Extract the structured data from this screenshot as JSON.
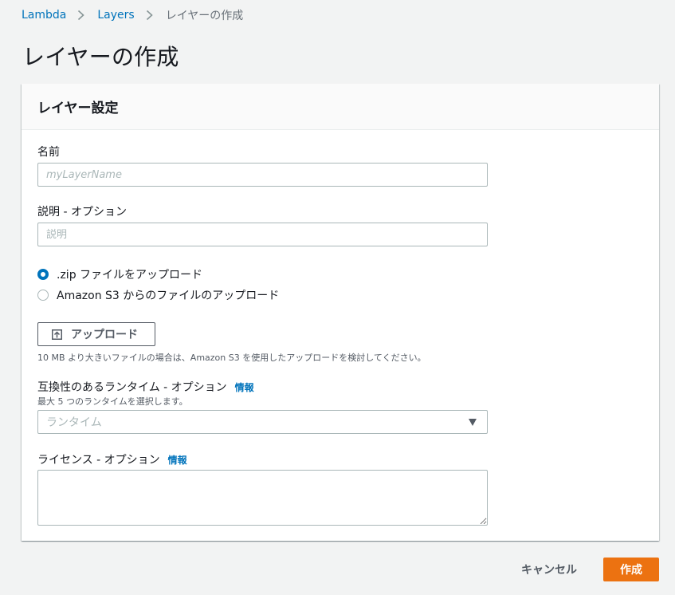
{
  "breadcrumb": {
    "items": [
      "Lambda",
      "Layers"
    ],
    "current": "レイヤーの作成"
  },
  "page": {
    "title": "レイヤーの作成"
  },
  "panel": {
    "title": "レイヤー設定"
  },
  "form": {
    "name": {
      "label": "名前",
      "placeholder": "myLayerName",
      "value": ""
    },
    "description": {
      "label": "説明 - オプション",
      "placeholder": "説明",
      "value": ""
    },
    "upload_options": [
      {
        "label": ".zip ファイルをアップロード",
        "selected": true
      },
      {
        "label": "Amazon S3 からのファイルのアップロード",
        "selected": false
      }
    ],
    "upload_button": {
      "label": "アップロード",
      "icon": "upload-icon"
    },
    "upload_hint": "10 MB より大きいファイルの場合は、Amazon S3 を使用したアップロードを検討してください。",
    "runtimes": {
      "label": "互換性のあるランタイム - オプション",
      "info": "情報",
      "hint": "最大 5 つのランタイムを選択します。",
      "placeholder": "ランタイム",
      "icon": "caret-down-icon"
    },
    "license": {
      "label": "ライセンス - オプション",
      "info": "情報",
      "value": ""
    }
  },
  "actions": {
    "cancel": "キャンセル",
    "create": "作成"
  },
  "colors": {
    "link": "#0073bb",
    "primary": "#ec7211",
    "background": "#f2f3f3",
    "border": "#aab7b8"
  }
}
